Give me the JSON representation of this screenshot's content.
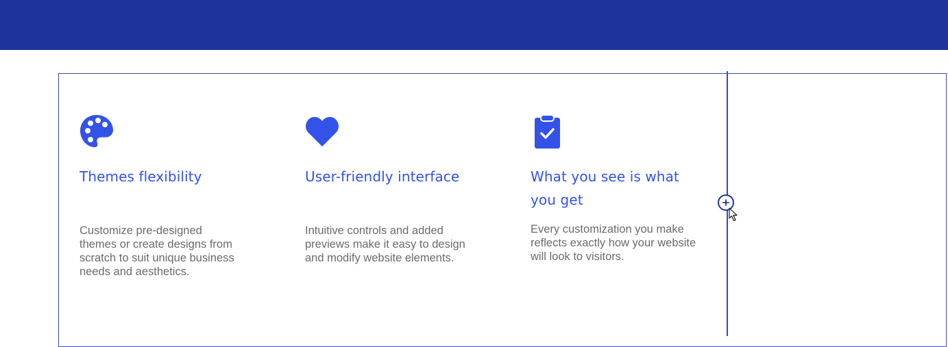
{
  "colors": {
    "topbar": "#1f339c",
    "accent": "#3352e8",
    "body_text": "#6a6a6a",
    "border": "#3a4bb0"
  },
  "features": [
    {
      "icon": "palette-icon",
      "title": "Themes flexibility",
      "description": "Customize pre-designed themes or create designs from scratch to suit unique business needs and aesthetics."
    },
    {
      "icon": "heart-icon",
      "title": "User-friendly interface",
      "description": "Intuitive controls and added previews make it easy to design and modify website elements."
    },
    {
      "icon": "clipboard-check-icon",
      "title": "What you see is what you get",
      "description": "Every customization you make reflects exactly how your website will look to visitors."
    }
  ],
  "editor": {
    "add_handle_icon": "plus-icon",
    "cursor_icon": "mouse-pointer-icon"
  }
}
